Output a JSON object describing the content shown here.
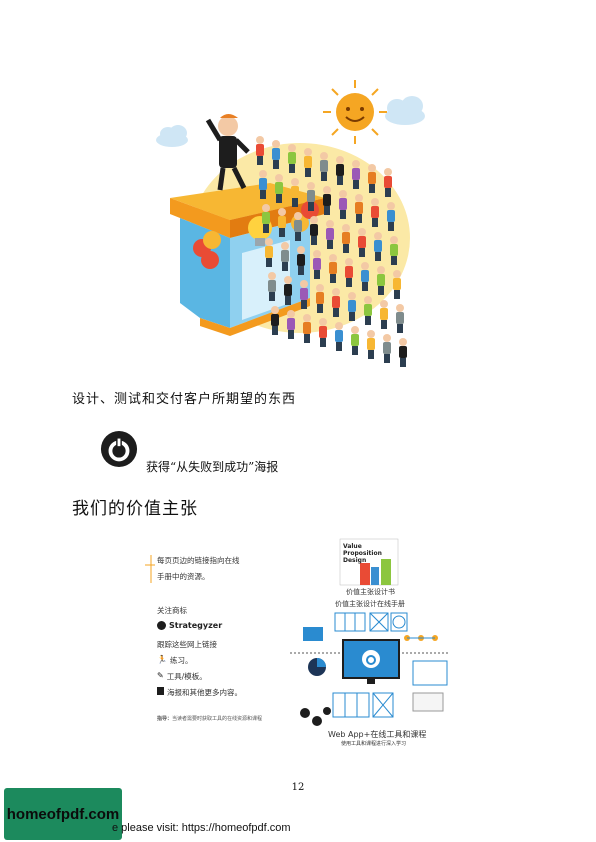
{
  "doc": {
    "caption": "设计、测试和交付客户所期望的东西",
    "poster_text": "获得“从失败到成功”海报",
    "section_title": "我们的价值主张",
    "page_number": "12"
  },
  "guide": {
    "link_note_line1": "每页页边的链接指向在线",
    "link_note_line2": "手册中的资源。",
    "follow_label": "关注商标",
    "brand_name": "Strategyzer",
    "follow_links": "跟踪这些网上链接",
    "item_practice": "练习。",
    "item_tools": "工具/模板。",
    "item_posters": "海报和其他更多内容。",
    "book_title_line1": "Value",
    "book_title_line2": "Proposition",
    "book_title_line3": "Design",
    "book_caption": "价值主张设计书",
    "handbook_caption": "价值主张设计在线手册",
    "webapp_caption": "Web App+在线工具和课程",
    "webapp_sub": "使用工具和课程进行深入学习",
    "note_label": "指导：",
    "note_text": "当读者需要时获取工具的在线资源和课程"
  },
  "footer": {
    "badge": "homeofpdf.com",
    "line": "e please visit: https://homeofpdf.com"
  },
  "colors": {
    "sun": "#f5a623",
    "building_orange": "#f39a1e",
    "building_blue": "#5ab6e3",
    "brand_dark": "#1d1d1d",
    "badge_green": "#1c8a5d",
    "app_blue": "#2a8bd0"
  }
}
